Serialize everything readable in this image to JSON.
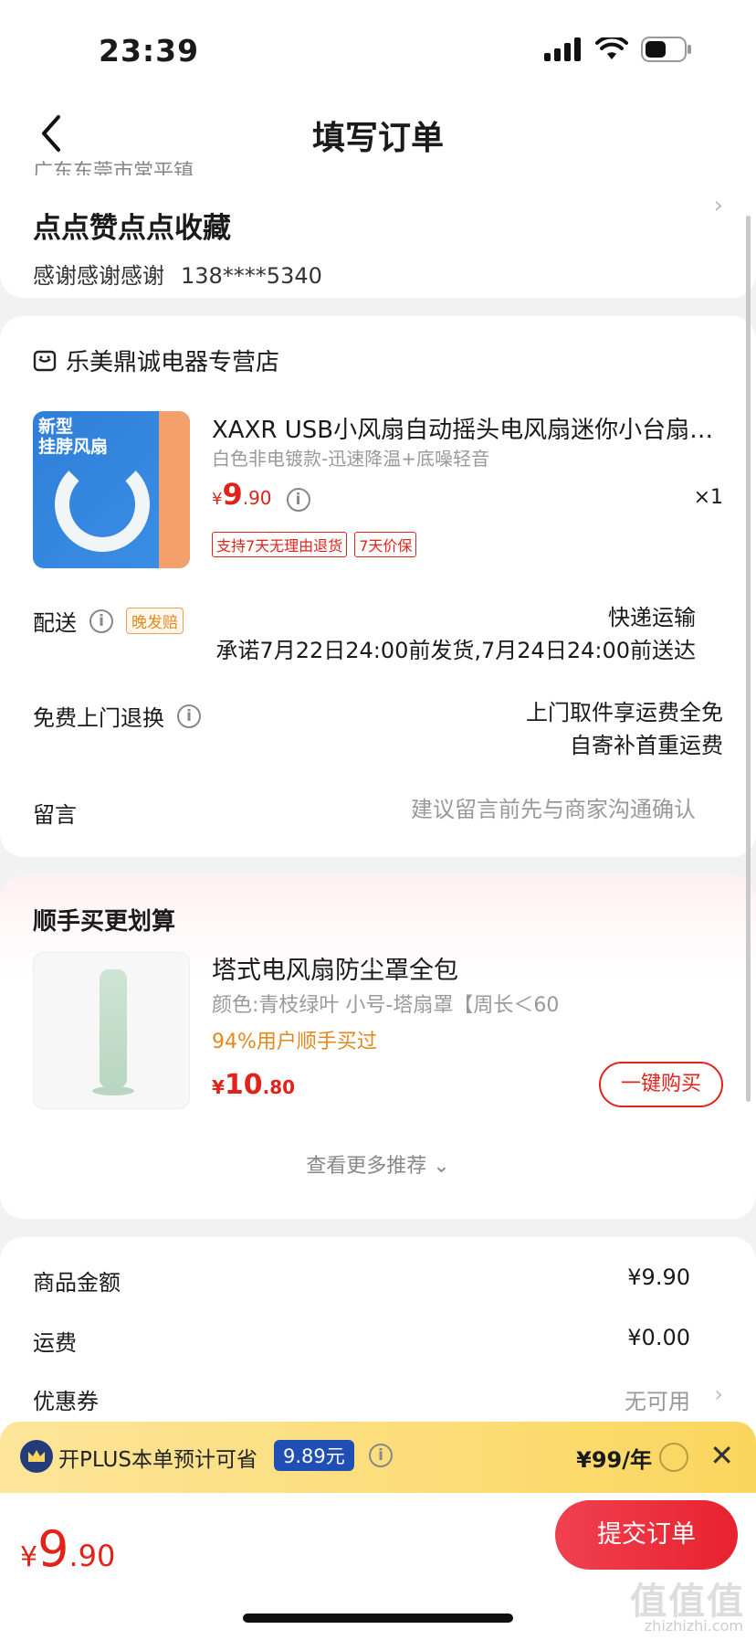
{
  "status_bar": {
    "time": "23:39"
  },
  "navbar": {
    "title": "填写订单"
  },
  "address": {
    "location": "广东东莞市常平镇",
    "name": "点点赞点点收藏",
    "recipient": "感谢感谢感谢",
    "phone": "138****5340"
  },
  "order": {
    "store_name": "乐美鼎诚电器专营店",
    "product": {
      "image_text": "新型\n挂脖风扇",
      "title": "XAXR USB小风扇自动摇头电风扇迷你小台扇可…",
      "spec": "白色非电镀款-迅速降温+底噪轻音",
      "price_yen": "¥",
      "price_int": "9",
      "price_dec": ".90",
      "quantity": "×1",
      "tags": [
        "支持7天无理由退货",
        "7天价保"
      ]
    },
    "delivery": {
      "label": "配送",
      "late_tag": "晚发赔",
      "method": "快递运输",
      "promise": "承诺7月22日24:00前发货,7月24日24:00前送达"
    },
    "return_service": {
      "label": "免费上门退换",
      "line1": "上门取件享运费全免",
      "line2": "自寄补首重运费"
    },
    "message": {
      "label": "留言",
      "placeholder": "建议留言前先与商家沟通确认"
    }
  },
  "recommend": {
    "title": "顺手买更划算",
    "item": {
      "name": "塔式电风扇防尘罩全包",
      "spec": "颜色:青枝绿叶 小号-塔扇罩【周长＜60",
      "rate": "94%用户顺手买过",
      "price_yen": "¥",
      "price_int": "10",
      "price_dec": ".80",
      "button": "一键购买"
    },
    "more": "查看更多推荐 ⌄"
  },
  "summary": {
    "goods_label": "商品金额",
    "goods_value": "¥9.90",
    "shipping_label": "运费",
    "shipping_value": "¥0.00",
    "coupon_label": "优惠券",
    "coupon_value": "无可用"
  },
  "plus_bar": {
    "text": "开PLUS本单预计可省",
    "saving": "9.89元",
    "price": "¥99/年"
  },
  "bottom": {
    "total_yen": "¥",
    "total_int": "9",
    "total_dec": ".90",
    "submit": "提交订单",
    "watermark": "值值值",
    "watermark_url": "zhizhizhi.com"
  },
  "colors": {
    "accent": "#e2231a",
    "plus_badge": "#1f4fb5",
    "plus_bar": "#fbd65e"
  }
}
